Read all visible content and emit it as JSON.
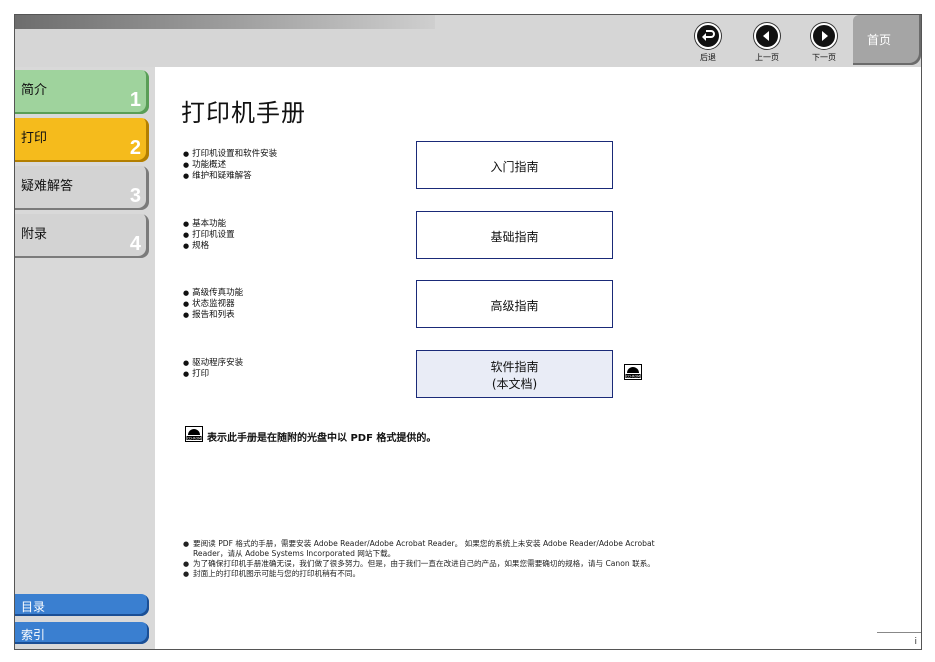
{
  "nav": {
    "back_label": "后退",
    "prev_label": "上一页",
    "next_label": "下一页",
    "home_label": "首页"
  },
  "sidebar": {
    "tabs": [
      {
        "label": "简介",
        "number": "1"
      },
      {
        "label": "打印",
        "number": "2"
      },
      {
        "label": "疑难解答",
        "number": "3"
      },
      {
        "label": "附录",
        "number": "4"
      }
    ],
    "links": [
      {
        "label": "目录"
      },
      {
        "label": "索引"
      }
    ]
  },
  "page": {
    "title": "打印机手册",
    "sections": [
      {
        "features": [
          "打印机设置和软件安装",
          "功能概述",
          "维护和疑难解答"
        ],
        "guide": [
          "入门指南"
        ]
      },
      {
        "features": [
          "基本功能",
          "打印机设置",
          "规格"
        ],
        "guide": [
          "基础指南"
        ]
      },
      {
        "features": [
          "高级传真功能",
          "状态监视器",
          "报告和列表"
        ],
        "guide": [
          "高级指南"
        ]
      },
      {
        "features": [
          "驱动程序安装",
          "打印"
        ],
        "guide": [
          "软件指南",
          "(本文档)"
        ]
      }
    ],
    "cd_note": "表示此手册是在随附的光盘中以 PDF 格式提供的。",
    "cd_icon_text": "CD-ROM",
    "footnotes": [
      "要阅读 PDF 格式的手册，需要安装 Adobe Reader/Adobe Acrobat Reader。 如果您的系统上未安装 Adobe Reader/Adobe Acrobat Reader，请从 Adobe Systems Incorporated 网站下载。",
      "为了确保打印机手册准确无误，我们做了很多努力。但是，由于我们一直在改进自己的产品，如果您需要确切的规格，请与 Canon 联系。",
      "封面上的打印机图示可能与您的打印机稍有不同。"
    ],
    "page_number": "i"
  }
}
